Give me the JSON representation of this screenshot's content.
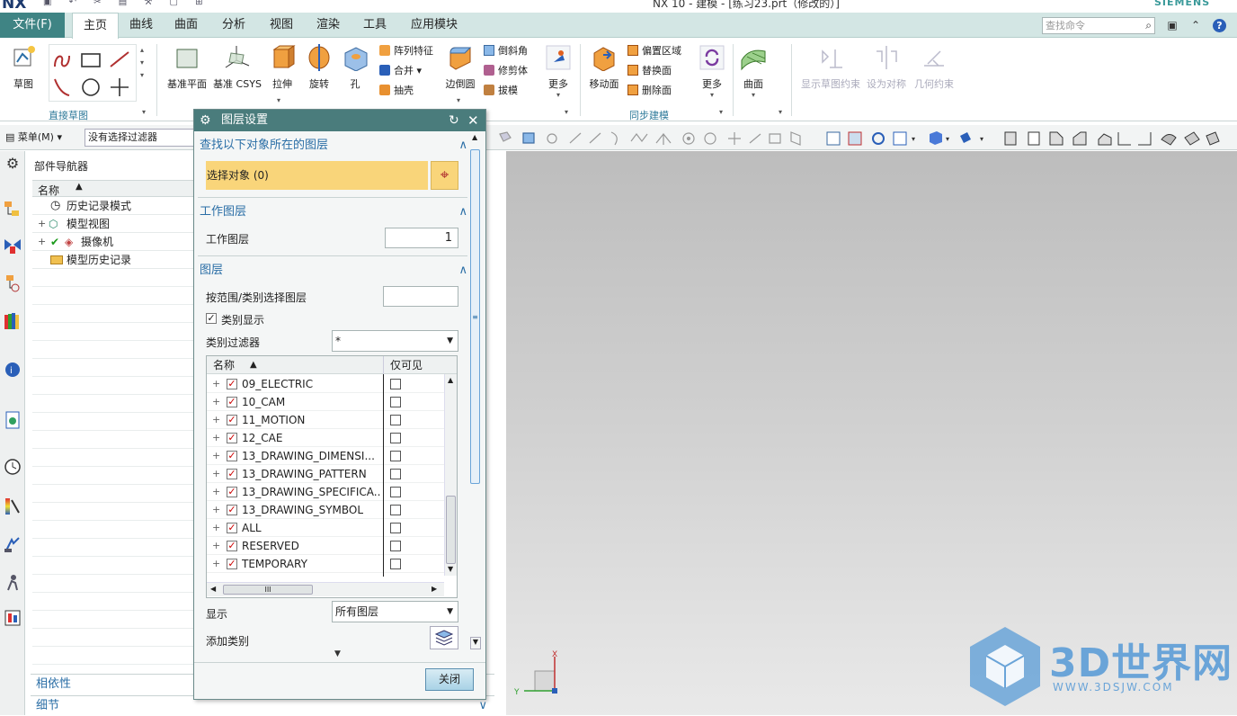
{
  "window": {
    "logo": "NX",
    "title": "NX 10 - 建模 - [练习23.prt（修改的）]",
    "brand": "SIEMENS"
  },
  "tabs": {
    "file": "文件(F)",
    "items": [
      "主页",
      "曲线",
      "曲面",
      "分析",
      "视图",
      "渲染",
      "工具",
      "应用模块"
    ]
  },
  "search": {
    "placeholder": "查找命令"
  },
  "ribbon": {
    "sketch": "草图",
    "direct_sketch_group": "直接草图",
    "datum_plane": "基准平面",
    "datum_csys": "基准 CSYS",
    "extrude": "拉伸",
    "revolve": "旋转",
    "hole": "孔",
    "pattern_feature": "阵列特征",
    "unite": "合并",
    "shell": "抽壳",
    "edge_blend": "边倒圆",
    "chamfer": "倒斜角",
    "trim_body": "修剪体",
    "draft": "拔模",
    "more1": "更多",
    "move_face": "移动面",
    "offset_region": "偏置区域",
    "replace_face": "替换面",
    "delete_face": "删除面",
    "more2": "更多",
    "sync_group": "同步建模",
    "surface": "曲面",
    "show_sketch_constraints": "显示草图约束",
    "set_symmetric": "设为对称",
    "geometric_constraints": "几何约束"
  },
  "toolbar": {
    "menu": "菜单(M)",
    "filter": "没有选择过滤器"
  },
  "navigator": {
    "title": "部件导航器",
    "col_name": "名称",
    "items": [
      "历史记录模式",
      "模型视图",
      "摄像机",
      "模型历史记录"
    ],
    "dependency": "相依性",
    "details": "细节"
  },
  "dialog": {
    "title": "图层设置",
    "sec_find": "查找以下对象所在的图层",
    "select_object": "选择对象 (0)",
    "sec_work": "工作图层",
    "work_layer_label": "工作图层",
    "work_layer_value": "1",
    "sec_layers": "图层",
    "select_by_range": "按范围/类别选择图层",
    "category_display": "类别显示",
    "category_display_checked": true,
    "category_filter_label": "类别过滤器",
    "category_filter_value": "*",
    "col_name": "名称",
    "col_visible_only": "仅可见",
    "layers": [
      "09_ELECTRIC",
      "10_CAM",
      "11_MOTION",
      "12_CAE",
      "13_DRAWING_DIMENSI...",
      "13_DRAWING_PATTERN",
      "13_DRAWING_SPECIFICA...",
      "13_DRAWING_SYMBOL",
      "ALL",
      "RESERVED",
      "TEMPORARY"
    ],
    "hscroll_label": "III",
    "display_label": "显示",
    "display_value": "所有图层",
    "add_category": "添加类别",
    "close": "关闭"
  },
  "axes": {
    "x": "X",
    "y": "Y"
  },
  "watermark": {
    "brand": "3D世界网",
    "url": "WWW.3DSJW.COM"
  },
  "colors": {
    "accent": "#4a7c7c",
    "file_tab": "#3f8484",
    "selection": "#f9d57a",
    "link": "#2a6ea6"
  }
}
